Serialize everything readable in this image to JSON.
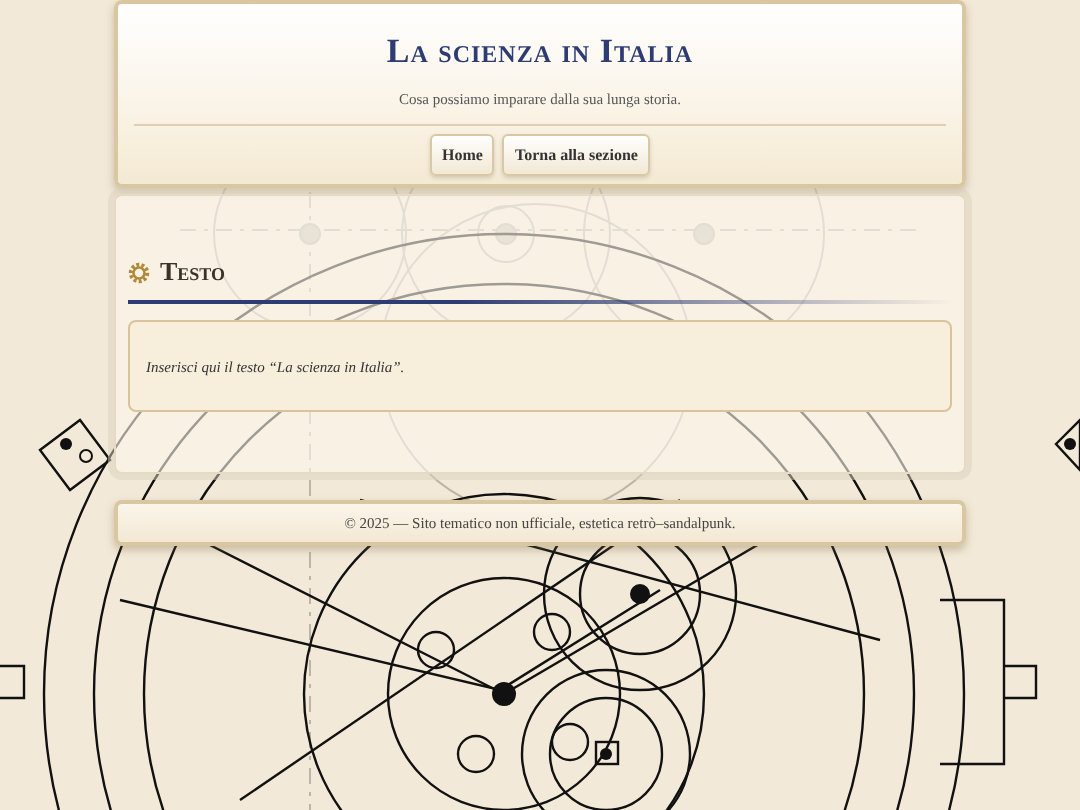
{
  "header": {
    "title": "La scienza in Italia",
    "subtitle": "Cosa possiamo imparare dalla sua lunga storia.",
    "nav": [
      {
        "label": "Home"
      },
      {
        "label": "Torna alla sezione"
      }
    ]
  },
  "section": {
    "heading": "Testo",
    "body": "Inserisci qui il testo “La scienza in Italia”."
  },
  "footer": {
    "text": "© 2025 — Sito tematico non ufficiale, estetica retrò–sandalpunk."
  }
}
